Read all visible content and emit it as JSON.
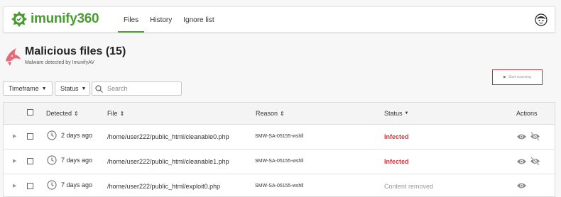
{
  "app": {
    "logo_text": "imunify360",
    "nav": [
      {
        "label": "Files",
        "active": true
      },
      {
        "label": "History",
        "active": false
      },
      {
        "label": "Ignore list",
        "active": false
      }
    ]
  },
  "header": {
    "title": "Malicious files (15)",
    "subtitle": "Malware detected by ImunifyAV",
    "scan_button": "Start scanning"
  },
  "filters": {
    "timeframe": "Timeframe",
    "status": "Status",
    "search_placeholder": "Search"
  },
  "table": {
    "columns": {
      "detected": "Detected",
      "file": "File",
      "reason": "Reason",
      "status": "Status",
      "actions": "Actions"
    },
    "rows": [
      {
        "detected": "2 days ago",
        "file": "/home/user222/public_html/cleanable0.php",
        "reason": "SMW-SA-05155-wshll",
        "status": "Infected",
        "actions": [
          "eye-icon",
          "eye-slash-icon"
        ]
      },
      {
        "detected": "7 days ago",
        "file": "/home/user222/public_html/cleanable1.php",
        "reason": "SMW-SA-05155-wshll",
        "status": "Infected",
        "actions": [
          "eye-icon",
          "eye-slash-icon"
        ]
      },
      {
        "detected": "7 days ago",
        "file": "/home/user222/public_html/exploit0.php",
        "reason": "SMW-SA-05155-wshll",
        "status": "Content removed",
        "actions": [
          "eye-icon"
        ]
      }
    ]
  },
  "colors": {
    "brand": "#4a9b32",
    "infected": "#d9363b",
    "scan_border": "#b13033"
  }
}
